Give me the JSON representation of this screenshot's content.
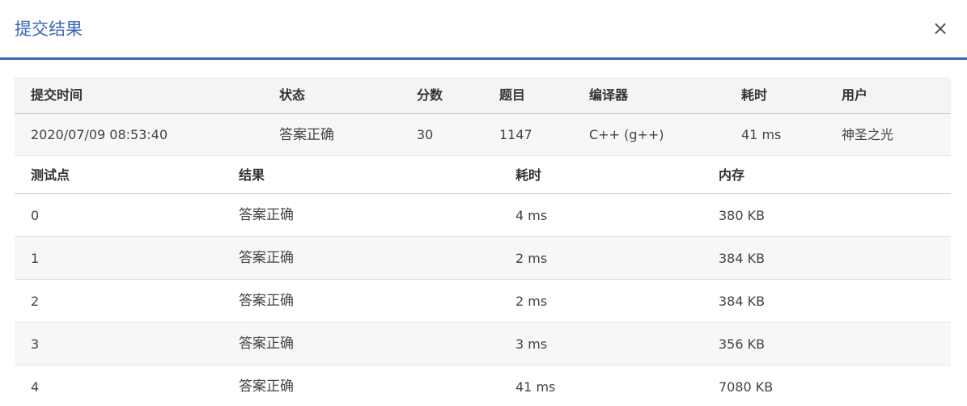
{
  "dialog": {
    "title": "提交结果",
    "close_label": "×"
  },
  "summary": {
    "headers": [
      "提交时间",
      "状态",
      "分数",
      "题目",
      "编译器",
      "耗时",
      "用户"
    ],
    "row": {
      "time": "2020/07/09 08:53:40",
      "status": "答案正确",
      "score": "30",
      "problem": "1147",
      "compiler": "C++ (g++)",
      "elapsed": "41 ms",
      "user": "神圣之光"
    }
  },
  "cases": {
    "headers": [
      "测试点",
      "结果",
      "耗时",
      "内存"
    ],
    "rows": [
      {
        "id": "0",
        "result": "答案正确",
        "time": "4 ms",
        "memory": "380 KB"
      },
      {
        "id": "1",
        "result": "答案正确",
        "time": "2 ms",
        "memory": "384 KB"
      },
      {
        "id": "2",
        "result": "答案正确",
        "time": "2 ms",
        "memory": "384 KB"
      },
      {
        "id": "3",
        "result": "答案正确",
        "time": "3 ms",
        "memory": "356 KB"
      },
      {
        "id": "4",
        "result": "答案正确",
        "time": "41 ms",
        "memory": "7080 KB"
      }
    ]
  },
  "colors": {
    "accent": "#3a66b7",
    "status_ok": "#e0413c",
    "link": "#2c61ad"
  }
}
